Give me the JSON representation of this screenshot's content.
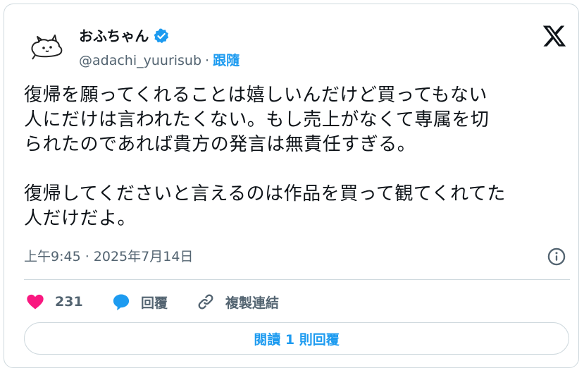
{
  "author": {
    "name": "おふちゃん",
    "handle": "@adachi_yuurisub",
    "separator": "·",
    "follow_label": "跟隨"
  },
  "tweet": {
    "text": "復帰を願ってくれることは嬉しいんだけど買ってもない\n人にだけは言われたくない。もし売上がなくて専属を切\nられたのであれば貴方の発言は無責任すぎる。\n\n復帰してくださいと言えるのは作品を買って観てくれてた\n人だけだよ。",
    "timestamp": "上午9:45 · 2025年7月14日"
  },
  "actions": {
    "like_count": "231",
    "reply_label": "回覆",
    "copy_link_label": "複製連結"
  },
  "read_replies_label": "閱讀 1 則回覆",
  "colors": {
    "accent": "#1d9bf0",
    "like": "#f91880",
    "muted": "#536471",
    "border": "#cfd9de"
  },
  "icons": [
    "avatar-doodle",
    "verified-badge-icon",
    "x-logo-icon",
    "info-icon",
    "heart-icon",
    "reply-bubble-icon",
    "link-icon"
  ]
}
